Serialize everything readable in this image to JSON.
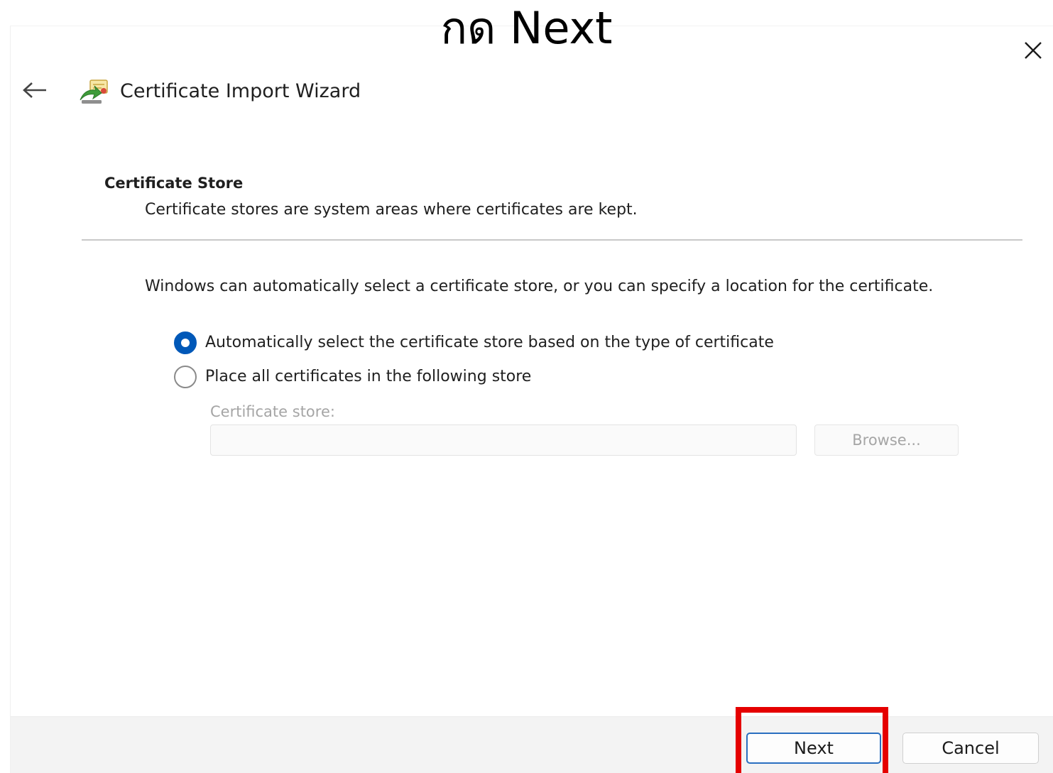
{
  "annotation": {
    "text": "กด Next",
    "highlight_color": "#e50000"
  },
  "window": {
    "title": "Certificate Import Wizard",
    "back_icon": "arrow-left-icon",
    "app_icon": "certificate-wizard-icon",
    "close_icon": "close-icon"
  },
  "section": {
    "heading": "Certificate Store",
    "description": "Certificate stores are system areas where certificates are kept."
  },
  "body": {
    "intro": "Windows can automatically select a certificate store, or you can specify a location for the certificate.",
    "options": [
      {
        "label": "Automatically select the certificate store based on the type of certificate",
        "selected": true
      },
      {
        "label": "Place all certificates in the following store",
        "selected": false
      }
    ],
    "store_label": "Certificate store:",
    "store_value": "",
    "browse_label": "Browse..."
  },
  "footer": {
    "next_label": "Next",
    "cancel_label": "Cancel"
  },
  "colors": {
    "accent": "#0058b8",
    "button_focus_border": "#2a6fc0",
    "footer_background": "#f3f3f3",
    "disabled_text": "#a5a5a5"
  }
}
